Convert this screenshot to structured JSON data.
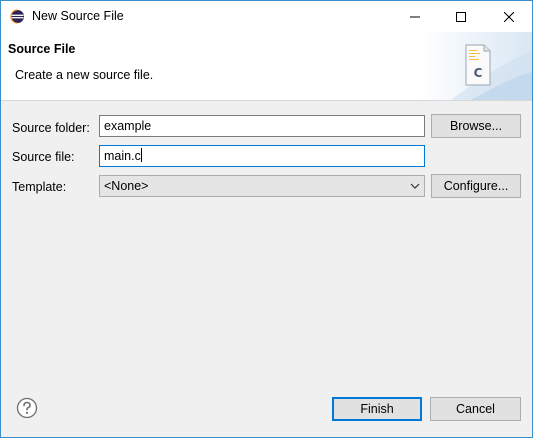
{
  "window": {
    "title": "New Source File"
  },
  "banner": {
    "title": "Source File",
    "description": "Create a new source file.",
    "icon_letter": "C"
  },
  "form": {
    "source_folder": {
      "label": "Source folder:",
      "value": "example",
      "browse_label": "Browse..."
    },
    "source_file": {
      "label": "Source file:",
      "value": "main.c"
    },
    "template": {
      "label": "Template:",
      "selected": "<None>",
      "configure_label": "Configure..."
    }
  },
  "footer": {
    "finish_label": "Finish",
    "cancel_label": "Cancel"
  },
  "icons": {
    "app": "eclipse-icon",
    "minimize": "minimize-icon",
    "maximize": "maximize-icon",
    "close": "close-icon",
    "help": "help-icon",
    "dropdown": "chevron-down-icon"
  },
  "colors": {
    "accent": "#0078d7",
    "window_border": "#3a8ec9"
  }
}
